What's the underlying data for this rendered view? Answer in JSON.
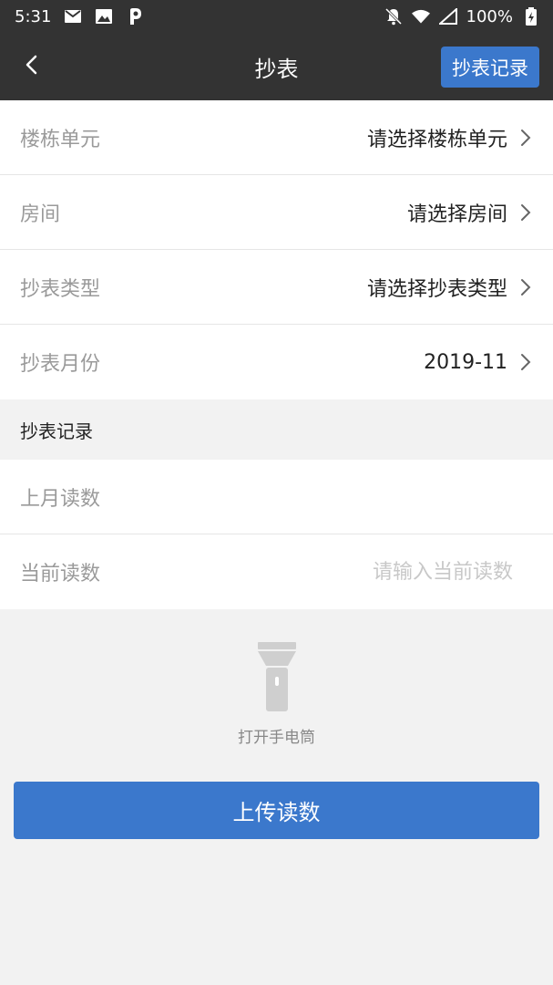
{
  "status_bar": {
    "time": "5:31",
    "battery": "100%",
    "icons": [
      "mail-icon",
      "image-icon",
      "p-app-icon",
      "bell-off-icon",
      "wifi-icon",
      "signal-icon",
      "battery-icon"
    ]
  },
  "navbar": {
    "back_icon": "chevron-left-icon",
    "title": "抄表",
    "record_button": "抄表记录"
  },
  "form": {
    "building": {
      "label": "楼栋单元",
      "value": "请选择楼栋单元"
    },
    "room": {
      "label": "房间",
      "value": "请选择房间"
    },
    "meter_type": {
      "label": "抄表类型",
      "value": "请选择抄表类型"
    },
    "month": {
      "label": "抄表月份",
      "value": "2019-11"
    }
  },
  "records_section": {
    "title": "抄表记录",
    "last_reading": {
      "label": "上月读数",
      "value": ""
    },
    "current_reading": {
      "label": "当前读数",
      "value": "",
      "placeholder": "请输入当前读数"
    }
  },
  "flashlight": {
    "label": "打开手电筒",
    "icon": "flashlight-icon"
  },
  "upload_button": "上传读数",
  "colors": {
    "header_bg": "#333333",
    "accent": "#3b78cc",
    "page_bg": "#f2f2f2"
  }
}
